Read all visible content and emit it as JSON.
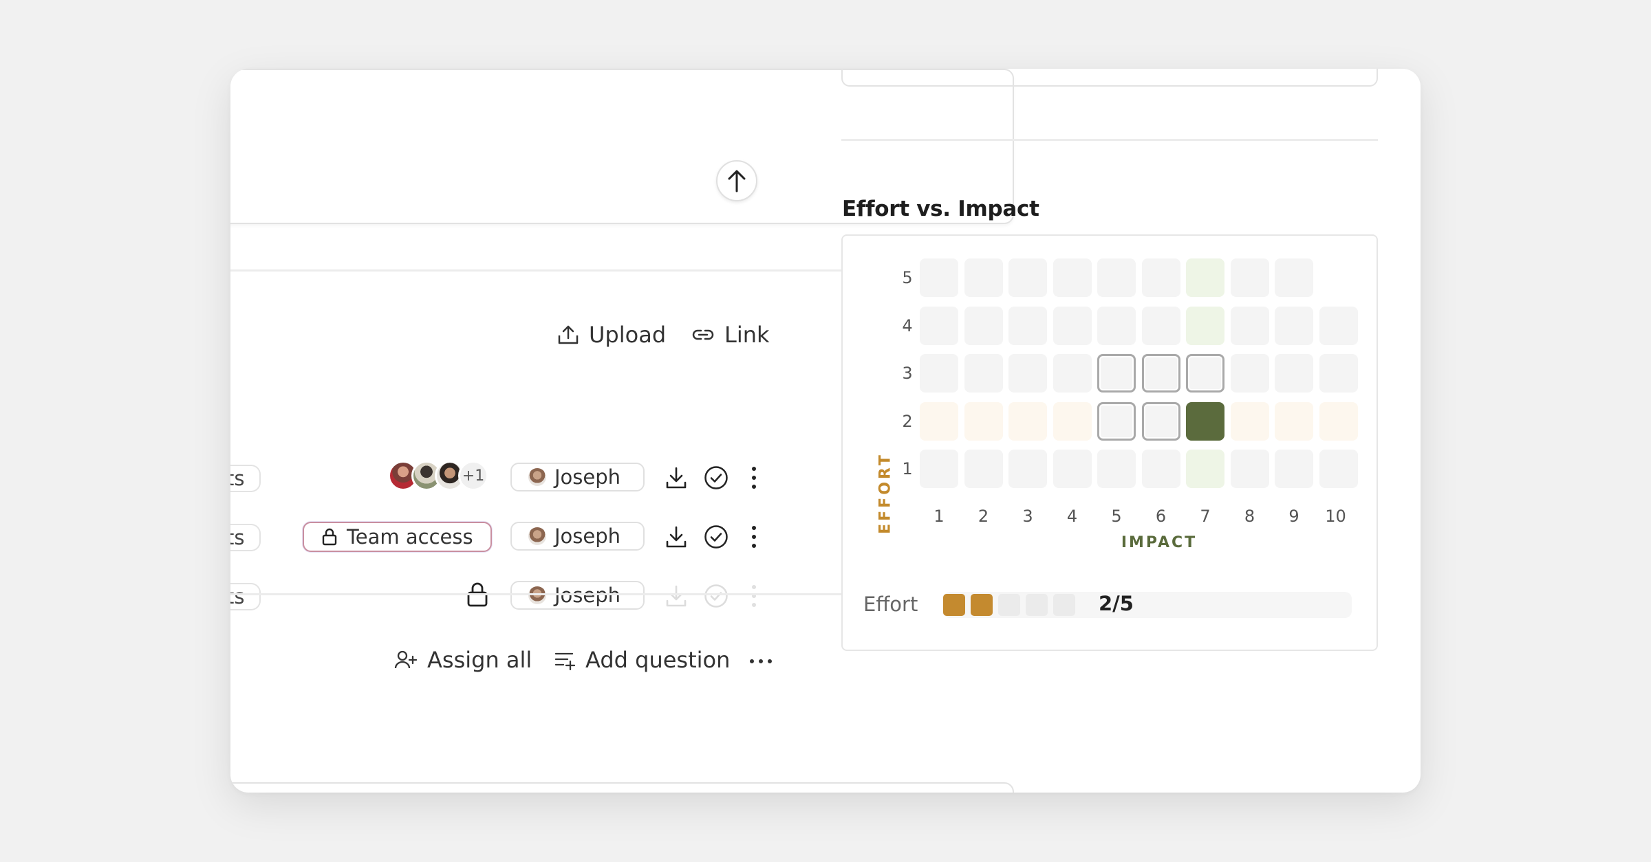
{
  "actions": {
    "upload_label": "Upload",
    "link_label": "Link",
    "assign_all_label": "Assign all",
    "add_question_label": "Add question"
  },
  "rows": [
    {
      "tag_fragment": "ts",
      "avatar_extra": "+1",
      "owner": "Joseph",
      "state": "active"
    },
    {
      "tag_fragment": "ts",
      "access_label": "Team access",
      "owner": "Joseph",
      "state": "active"
    },
    {
      "tag_fragment": "ts",
      "owner": "Joseph",
      "state": "locked"
    }
  ],
  "chart": {
    "title": "Effort vs. Impact",
    "y_axis_label": "EFFORT",
    "x_axis_label": "IMPACT",
    "effort_label": "Effort",
    "effort_value": "2/5"
  },
  "chart_data": {
    "type": "heatmap",
    "title": "Effort vs. Impact",
    "xlabel": "IMPACT",
    "ylabel": "EFFORT",
    "x": [
      1,
      2,
      3,
      4,
      5,
      6,
      7,
      8,
      9,
      10
    ],
    "y": [
      1,
      2,
      3,
      4,
      5
    ],
    "selected": {
      "impact": 7,
      "effort": 2
    },
    "outlined_cells": [
      [
        5,
        3
      ],
      [
        6,
        3
      ],
      [
        7,
        3
      ],
      [
        5,
        2
      ],
      [
        6,
        2
      ]
    ],
    "effort_score": 2,
    "effort_max": 5,
    "colors": {
      "selected": "#5b6b3d",
      "impact_column_tint": "#eef5e6",
      "effort_row_tint": "#fdf7ee",
      "empty": "#f4f4f4",
      "effort_filled": "#c48a2f",
      "effort_empty": "#ebebeb"
    }
  }
}
